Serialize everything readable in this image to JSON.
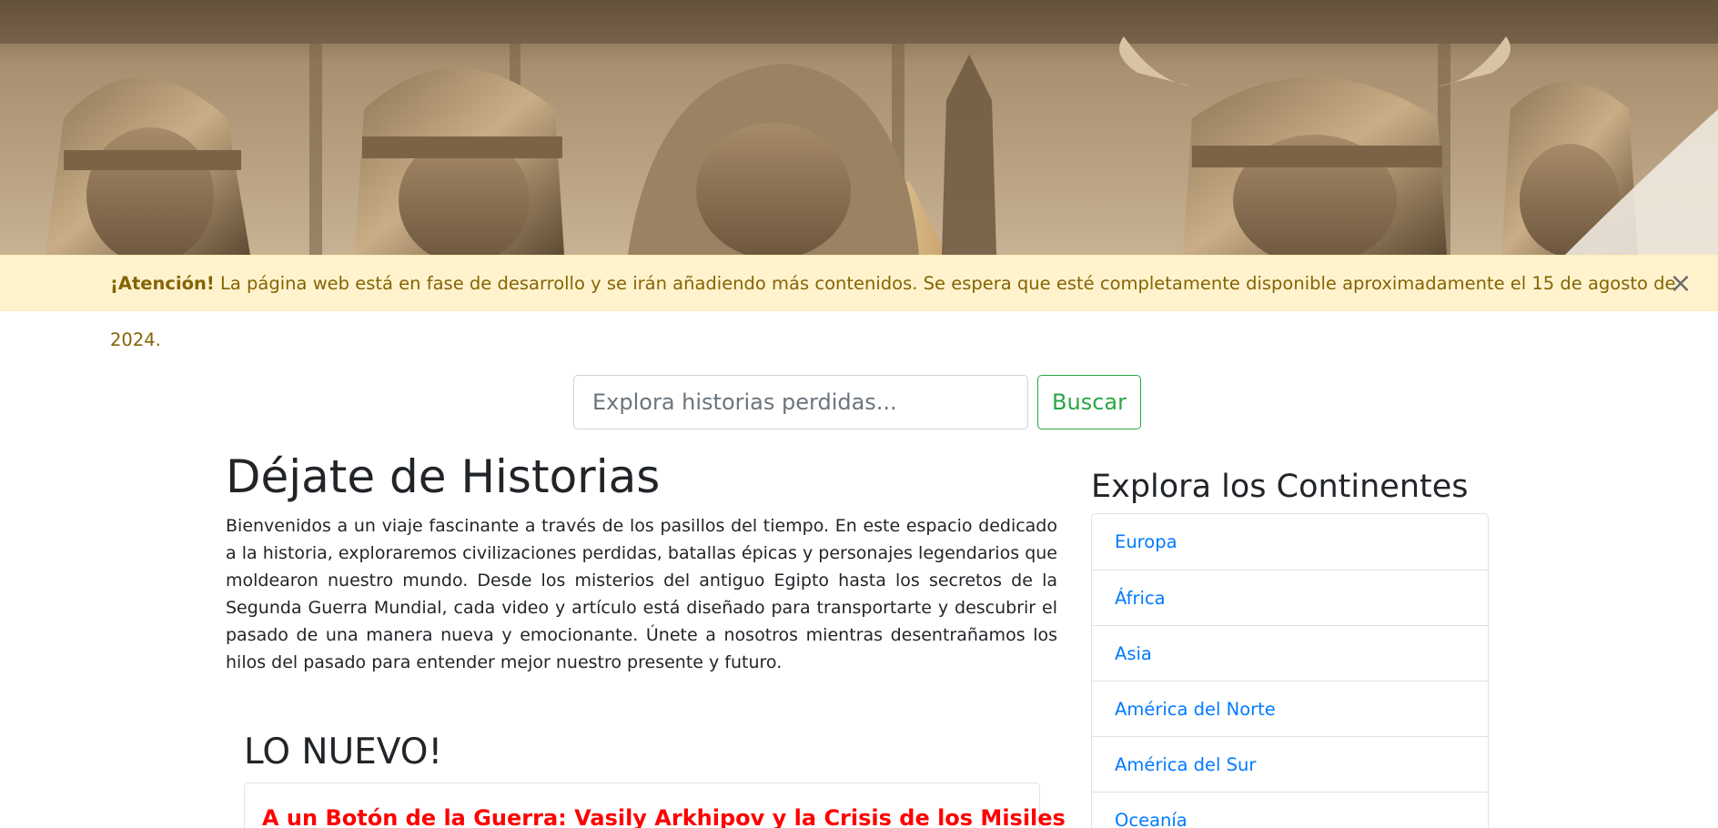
{
  "colors": {
    "alert_bg": "#fff3cd",
    "alert_text": "#856404",
    "link": "#007bff",
    "success": "#28a745",
    "card_title": "#ff0000"
  },
  "banner": {
    "image": "sepia-illustration-of-historical-warriors-in-helmets"
  },
  "alert": {
    "strong": "¡Atención!",
    "message": "La página web está en fase de desarrollo y se irán añadiendo más contenidos. Se espera que esté completamente disponible aproximadamente el 15 de agosto de 2024.",
    "close": "×"
  },
  "search": {
    "placeholder": "Explora historias perdidas...",
    "button_label": "Buscar"
  },
  "main": {
    "title": "Déjate de Historias",
    "intro": "Bienvenidos a un viaje fascinante a través de los pasillos del tiempo. En este espacio dedicado a la historia, exploraremos civilizaciones perdidas, batallas épicas y personajes legendarios que moldearon nuestro mundo. Desde los misterios del antiguo Egipto hasta los secretos de la Segunda Guerra Mundial, cada video y artículo está diseñado para transportarte y descubrir el pasado de una manera nueva y emocionante. Únete a nosotros mientras desentrañamos los hilos del pasado para entender mejor nuestro presente y futuro.",
    "new_heading": "LO NUEVO!",
    "latest_card_title": "A un Botón de la Guerra: Vasily Arkhipov y la Crisis de los Misiles"
  },
  "sidebar": {
    "title": "Explora los Continentes",
    "items": [
      {
        "label": "Europa"
      },
      {
        "label": "África"
      },
      {
        "label": "Asia"
      },
      {
        "label": "América del Norte"
      },
      {
        "label": "América del Sur"
      },
      {
        "label": "Oceanía"
      }
    ]
  }
}
